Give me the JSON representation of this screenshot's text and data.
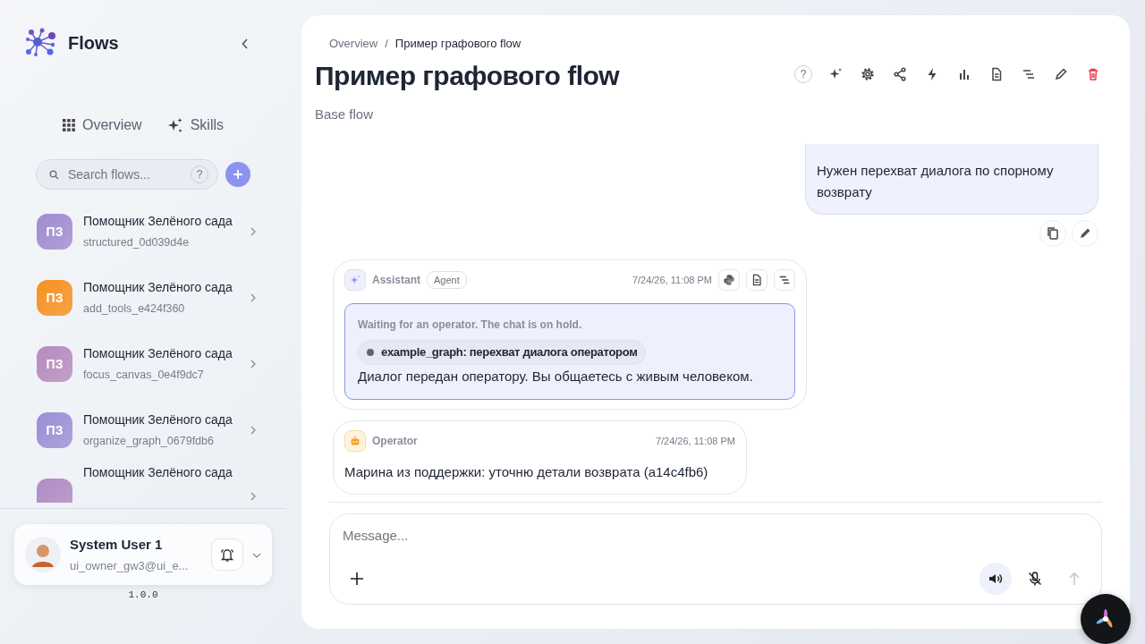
{
  "sidebar": {
    "brand": "Flows",
    "nav": [
      {
        "label": "Overview"
      },
      {
        "label": "Skills"
      }
    ],
    "search": {
      "placeholder": "Search flows...",
      "help": "?"
    },
    "flows": [
      {
        "initials": "ПЗ",
        "title": "Помощник Зелёного сада",
        "subtitle": "structured_0d039d4e",
        "color": "#a08bd0"
      },
      {
        "initials": "ПЗ",
        "title": "Помощник Зелёного сада",
        "subtitle": "add_tools_e424f360",
        "color": "#f7901f"
      },
      {
        "initials": "ПЗ",
        "title": "Помощник Зелёного сада",
        "subtitle": "focus_canvas_0e4f9dc7",
        "color": "#b68bbd"
      },
      {
        "initials": "ПЗ",
        "title": "Помощник Зелёного сада",
        "subtitle": "organize_graph_0679fdb6",
        "color": "#9a8fd4"
      },
      {
        "title": "Помощник Зелёного сада",
        "color": "#b08bc4"
      }
    ],
    "user": {
      "name": "System User 1",
      "email": "ui_owner_gw3@ui_e..."
    },
    "version": "1.0.0"
  },
  "header": {
    "breadcrumb": [
      "Overview",
      "Пример графового flow"
    ],
    "breadcrumb_separator": "/",
    "title": "Пример графового flow",
    "subtitle": "Base flow",
    "help": "?"
  },
  "messages": [
    {
      "kind": "user",
      "text": "Нужен перехват диалога по спорному возврату"
    },
    {
      "kind": "assistant",
      "author": "Assistant",
      "tag": "Agent",
      "time": "7/24/26, 11:08 PM",
      "notice": "Waiting for an operator. The chat is on hold.",
      "chip": "example_graph: перехват диалога оператором",
      "text": "Диалог передан оператору. Вы общаетесь с живым человеком."
    },
    {
      "kind": "operator",
      "author": "Operator",
      "time": "7/24/26, 11:08 PM",
      "text": "Марина из поддержки: уточню детали возврата (a14c4fb6)"
    }
  ],
  "composer": {
    "placeholder": "Message..."
  }
}
